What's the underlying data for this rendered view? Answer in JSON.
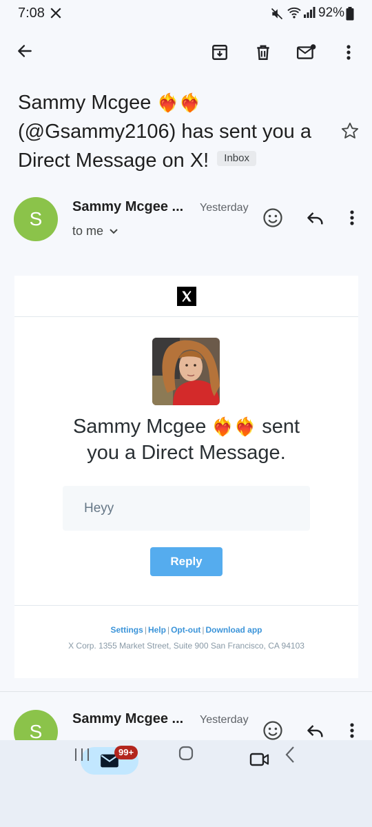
{
  "status_bar": {
    "time": "7:08",
    "battery": "92%"
  },
  "toolbar": {
    "back_icon": "arrow-left-icon",
    "archive_icon": "archive-icon",
    "delete_icon": "trash-icon",
    "mark_unread_icon": "mail-unread-icon",
    "more_icon": "more-vert-icon"
  },
  "email": {
    "subject_line1": "Sammy Mcgee",
    "subject_emoji": "❤️‍🔥❤️‍🔥",
    "subject_line2": "(@Gsammy2106) has sent you a",
    "subject_line3": "Direct Message on X!",
    "label": "Inbox"
  },
  "message1": {
    "avatar_letter": "S",
    "sender": "Sammy Mcgee ...",
    "date": "Yesterday",
    "recipient": "to me"
  },
  "body": {
    "headline_name": "Sammy Mcgee",
    "headline_emoji": "❤️‍🔥❤️‍🔥",
    "headline_rest": "sent",
    "headline_line2": "you a Direct Message.",
    "message_text": "Heyy",
    "reply_label": "Reply",
    "footer_links": [
      "Settings",
      "Help",
      "Opt-out",
      "Download app"
    ],
    "address": "X Corp. 1355 Market Street, Suite 900 San Francisco, CA 94103"
  },
  "message2": {
    "avatar_letter": "S",
    "sender": "Sammy Mcgee ...",
    "date": "Yesterday"
  },
  "bottom_nav": {
    "mail_badge": "99+",
    "accent": "#c2e7ff",
    "badge_color": "#b3261e"
  },
  "colors": {
    "avatar": "#8bc34a",
    "reply_button": "#55acee",
    "link": "#3b94d9"
  }
}
